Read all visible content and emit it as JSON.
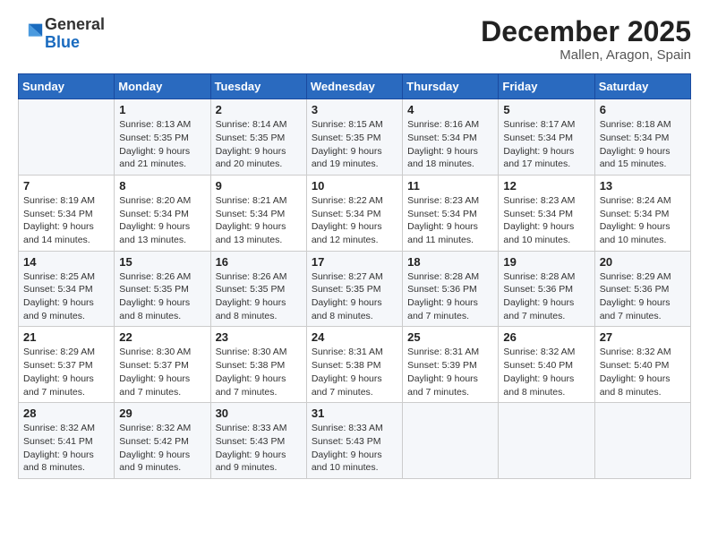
{
  "header": {
    "logo_general": "General",
    "logo_blue": "Blue",
    "title": "December 2025",
    "subtitle": "Mallen, Aragon, Spain"
  },
  "calendar": {
    "days_of_week": [
      "Sunday",
      "Monday",
      "Tuesday",
      "Wednesday",
      "Thursday",
      "Friday",
      "Saturday"
    ],
    "weeks": [
      [
        {
          "day": "",
          "sunrise": "",
          "sunset": "",
          "daylight": ""
        },
        {
          "day": "1",
          "sunrise": "Sunrise: 8:13 AM",
          "sunset": "Sunset: 5:35 PM",
          "daylight": "Daylight: 9 hours and 21 minutes."
        },
        {
          "day": "2",
          "sunrise": "Sunrise: 8:14 AM",
          "sunset": "Sunset: 5:35 PM",
          "daylight": "Daylight: 9 hours and 20 minutes."
        },
        {
          "day": "3",
          "sunrise": "Sunrise: 8:15 AM",
          "sunset": "Sunset: 5:35 PM",
          "daylight": "Daylight: 9 hours and 19 minutes."
        },
        {
          "day": "4",
          "sunrise": "Sunrise: 8:16 AM",
          "sunset": "Sunset: 5:34 PM",
          "daylight": "Daylight: 9 hours and 18 minutes."
        },
        {
          "day": "5",
          "sunrise": "Sunrise: 8:17 AM",
          "sunset": "Sunset: 5:34 PM",
          "daylight": "Daylight: 9 hours and 17 minutes."
        },
        {
          "day": "6",
          "sunrise": "Sunrise: 8:18 AM",
          "sunset": "Sunset: 5:34 PM",
          "daylight": "Daylight: 9 hours and 15 minutes."
        }
      ],
      [
        {
          "day": "7",
          "sunrise": "Sunrise: 8:19 AM",
          "sunset": "Sunset: 5:34 PM",
          "daylight": "Daylight: 9 hours and 14 minutes."
        },
        {
          "day": "8",
          "sunrise": "Sunrise: 8:20 AM",
          "sunset": "Sunset: 5:34 PM",
          "daylight": "Daylight: 9 hours and 13 minutes."
        },
        {
          "day": "9",
          "sunrise": "Sunrise: 8:21 AM",
          "sunset": "Sunset: 5:34 PM",
          "daylight": "Daylight: 9 hours and 13 minutes."
        },
        {
          "day": "10",
          "sunrise": "Sunrise: 8:22 AM",
          "sunset": "Sunset: 5:34 PM",
          "daylight": "Daylight: 9 hours and 12 minutes."
        },
        {
          "day": "11",
          "sunrise": "Sunrise: 8:23 AM",
          "sunset": "Sunset: 5:34 PM",
          "daylight": "Daylight: 9 hours and 11 minutes."
        },
        {
          "day": "12",
          "sunrise": "Sunrise: 8:23 AM",
          "sunset": "Sunset: 5:34 PM",
          "daylight": "Daylight: 9 hours and 10 minutes."
        },
        {
          "day": "13",
          "sunrise": "Sunrise: 8:24 AM",
          "sunset": "Sunset: 5:34 PM",
          "daylight": "Daylight: 9 hours and 10 minutes."
        }
      ],
      [
        {
          "day": "14",
          "sunrise": "Sunrise: 8:25 AM",
          "sunset": "Sunset: 5:34 PM",
          "daylight": "Daylight: 9 hours and 9 minutes."
        },
        {
          "day": "15",
          "sunrise": "Sunrise: 8:26 AM",
          "sunset": "Sunset: 5:35 PM",
          "daylight": "Daylight: 9 hours and 8 minutes."
        },
        {
          "day": "16",
          "sunrise": "Sunrise: 8:26 AM",
          "sunset": "Sunset: 5:35 PM",
          "daylight": "Daylight: 9 hours and 8 minutes."
        },
        {
          "day": "17",
          "sunrise": "Sunrise: 8:27 AM",
          "sunset": "Sunset: 5:35 PM",
          "daylight": "Daylight: 9 hours and 8 minutes."
        },
        {
          "day": "18",
          "sunrise": "Sunrise: 8:28 AM",
          "sunset": "Sunset: 5:36 PM",
          "daylight": "Daylight: 9 hours and 7 minutes."
        },
        {
          "day": "19",
          "sunrise": "Sunrise: 8:28 AM",
          "sunset": "Sunset: 5:36 PM",
          "daylight": "Daylight: 9 hours and 7 minutes."
        },
        {
          "day": "20",
          "sunrise": "Sunrise: 8:29 AM",
          "sunset": "Sunset: 5:36 PM",
          "daylight": "Daylight: 9 hours and 7 minutes."
        }
      ],
      [
        {
          "day": "21",
          "sunrise": "Sunrise: 8:29 AM",
          "sunset": "Sunset: 5:37 PM",
          "daylight": "Daylight: 9 hours and 7 minutes."
        },
        {
          "day": "22",
          "sunrise": "Sunrise: 8:30 AM",
          "sunset": "Sunset: 5:37 PM",
          "daylight": "Daylight: 9 hours and 7 minutes."
        },
        {
          "day": "23",
          "sunrise": "Sunrise: 8:30 AM",
          "sunset": "Sunset: 5:38 PM",
          "daylight": "Daylight: 9 hours and 7 minutes."
        },
        {
          "day": "24",
          "sunrise": "Sunrise: 8:31 AM",
          "sunset": "Sunset: 5:38 PM",
          "daylight": "Daylight: 9 hours and 7 minutes."
        },
        {
          "day": "25",
          "sunrise": "Sunrise: 8:31 AM",
          "sunset": "Sunset: 5:39 PM",
          "daylight": "Daylight: 9 hours and 7 minutes."
        },
        {
          "day": "26",
          "sunrise": "Sunrise: 8:32 AM",
          "sunset": "Sunset: 5:40 PM",
          "daylight": "Daylight: 9 hours and 8 minutes."
        },
        {
          "day": "27",
          "sunrise": "Sunrise: 8:32 AM",
          "sunset": "Sunset: 5:40 PM",
          "daylight": "Daylight: 9 hours and 8 minutes."
        }
      ],
      [
        {
          "day": "28",
          "sunrise": "Sunrise: 8:32 AM",
          "sunset": "Sunset: 5:41 PM",
          "daylight": "Daylight: 9 hours and 8 minutes."
        },
        {
          "day": "29",
          "sunrise": "Sunrise: 8:32 AM",
          "sunset": "Sunset: 5:42 PM",
          "daylight": "Daylight: 9 hours and 9 minutes."
        },
        {
          "day": "30",
          "sunrise": "Sunrise: 8:33 AM",
          "sunset": "Sunset: 5:43 PM",
          "daylight": "Daylight: 9 hours and 9 minutes."
        },
        {
          "day": "31",
          "sunrise": "Sunrise: 8:33 AM",
          "sunset": "Sunset: 5:43 PM",
          "daylight": "Daylight: 9 hours and 10 minutes."
        },
        {
          "day": "",
          "sunrise": "",
          "sunset": "",
          "daylight": ""
        },
        {
          "day": "",
          "sunrise": "",
          "sunset": "",
          "daylight": ""
        },
        {
          "day": "",
          "sunrise": "",
          "sunset": "",
          "daylight": ""
        }
      ]
    ]
  }
}
